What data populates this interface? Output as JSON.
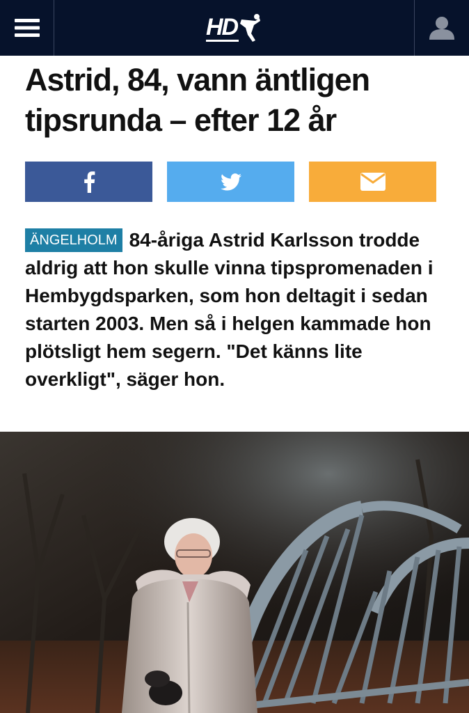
{
  "header": {
    "logo_text": "HD",
    "menu_icon": "hamburger-icon",
    "user_icon": "user-icon",
    "background_color": "#06122b"
  },
  "article": {
    "headline": "Astrid, 84, vann äntligen tipsrunda – efter 12 år",
    "location_tag": "ÄNGELHOLM",
    "lead": "84-åriga Astrid Karlsson trodde aldrig att hon skulle vinna tipspromenaden i Hembygdsparken, som hon deltagit i sedan starten 2003. Men så i helgen kammade hon plötsligt hem segern. \"Det känns lite overkligt\", säger hon.",
    "tag_color": "#1e7fa5"
  },
  "share": {
    "buttons": [
      {
        "network": "facebook",
        "icon": "facebook-icon",
        "color": "#3b5998"
      },
      {
        "network": "twitter",
        "icon": "twitter-icon",
        "color": "#55acee"
      },
      {
        "network": "email",
        "icon": "mail-icon",
        "color": "#f8ac3a"
      }
    ]
  }
}
